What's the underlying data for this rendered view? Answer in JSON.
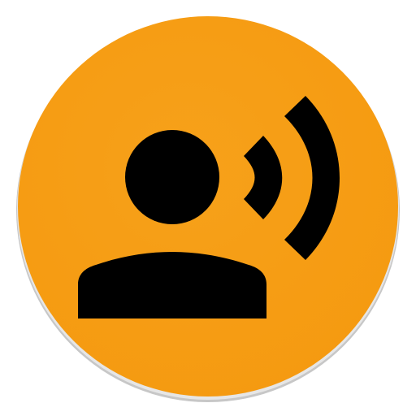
{
  "app_icon": {
    "icon": "voice-recognition-icon",
    "background_color": "#F7A11A",
    "background_edge_color": "#F59A10",
    "shadow_color": "#C7C7C7",
    "glyph_color": "#000000",
    "parts": {
      "person": "person-icon",
      "sound_waves": "sound-waves-icon"
    }
  }
}
